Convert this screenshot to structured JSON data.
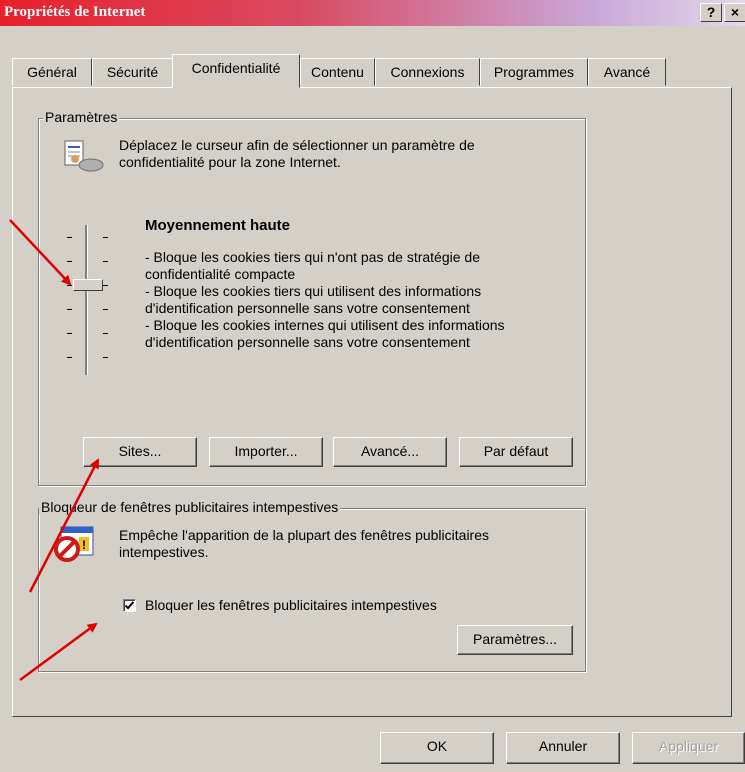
{
  "window": {
    "title": "Propriétés de Internet",
    "help_button": "?",
    "close_button": "×"
  },
  "tabs": [
    {
      "label": "Général",
      "active": false
    },
    {
      "label": "Sécurité",
      "active": false
    },
    {
      "label": "Confidentialité",
      "active": true
    },
    {
      "label": "Contenu",
      "active": false
    },
    {
      "label": "Connexions",
      "active": false
    },
    {
      "label": "Programmes",
      "active": false
    },
    {
      "label": "Avancé",
      "active": false
    }
  ],
  "settings": {
    "group_label": "Paramètres",
    "description": "Déplacez le curseur afin de sélectionner un paramètre de confidentialité pour la zone Internet.",
    "level_title": "Moyennement haute",
    "level_lines": [
      "- Bloque les cookies tiers qui n'ont pas de stratégie de",
      "confidentialité compacte",
      "- Bloque les cookies tiers qui utilisent des informations",
      "d'identification personnelle sans votre consentement",
      "- Bloque les cookies internes qui utilisent des informations",
      "d'identification personnelle sans votre consentement"
    ],
    "slider_level": "4 of 6",
    "buttons": {
      "sites": "Sites...",
      "import": "Importer...",
      "advanced": "Avancé...",
      "default": "Par défaut"
    }
  },
  "popup": {
    "group_label": "Bloqueur de fenêtres publicitaires intempestives",
    "description": "Empêche l'apparition de la plupart des fenêtres publicitaires intempestives.",
    "checkbox_label": "Bloquer les fenêtres publicitaires intempestives",
    "checkbox_checked": true,
    "settings_button": "Paramètres..."
  },
  "footer": {
    "ok": "OK",
    "cancel": "Annuler",
    "apply": "Appliquer"
  },
  "colors": {
    "annotation_arrow": "#e00000",
    "dialog_bg": "#d4d0c8"
  }
}
